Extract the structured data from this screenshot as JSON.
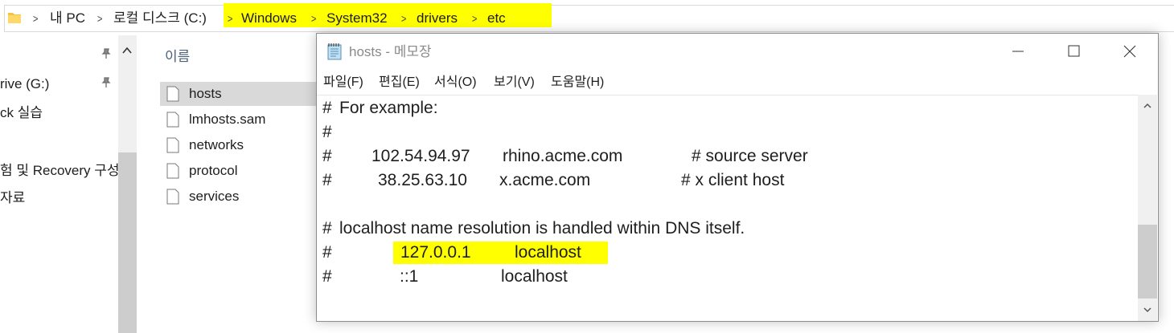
{
  "explorer": {
    "breadcrumb": {
      "items": [
        "내 PC",
        "로컬 디스크 (C:)",
        "Windows",
        "System32",
        "drivers",
        "etc"
      ]
    },
    "nav": {
      "items": [
        "rive (G:)",
        "ck 실습",
        "험 및 Recovery 구성",
        "자료"
      ]
    },
    "file_list": {
      "column_header": "이름",
      "files": [
        "hosts",
        "lmhosts.sam",
        "networks",
        "protocol",
        "services"
      ],
      "selected": "hosts"
    }
  },
  "notepad": {
    "title": "hosts - 메모장",
    "menu": [
      "파일(F)",
      "편집(E)",
      "서식(O)",
      "보기(V)",
      "도움말(H)"
    ],
    "lines": [
      {
        "hash": "#",
        "text": "For example:"
      },
      {
        "hash": "#",
        "text": ""
      },
      {
        "hash": "#",
        "ip": "102.54.94.97",
        "host": "rhino.acme.com",
        "comment": "# source server"
      },
      {
        "hash": "#",
        "ip": "38.25.63.10",
        "host": "x.acme.com",
        "comment": "# x client host"
      },
      {
        "hash": "#",
        "text": "localhost name resolution is handled within DNS itself."
      },
      {
        "hash": "#",
        "ip": "127.0.0.1",
        "host": "localhost"
      },
      {
        "hash": "#",
        "ip": "::1",
        "host": "localhost"
      }
    ]
  },
  "colors": {
    "highlight": "#ffff00",
    "selection": "#d9d9d9",
    "header_text": "#4c607a"
  },
  "icons": [
    "folder-icon",
    "chevron-right-icon",
    "pin-icon",
    "chevron-up-icon",
    "file-icon",
    "notepad-icon",
    "minimize-icon",
    "maximize-icon",
    "close-icon",
    "scroll-up-icon",
    "scroll-down-icon"
  ]
}
